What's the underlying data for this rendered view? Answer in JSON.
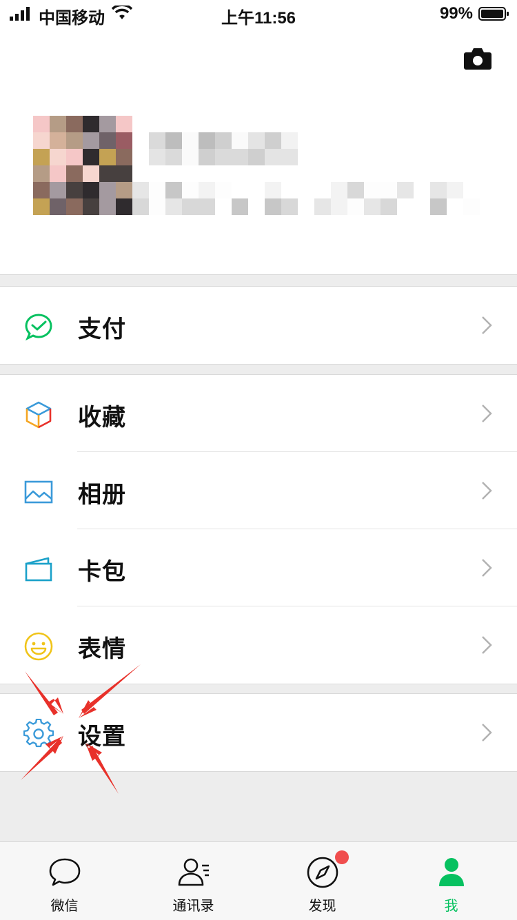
{
  "status_bar": {
    "carrier": "中国移动",
    "time": "上午11:56",
    "battery": "99%"
  },
  "profile": {
    "camera_icon": "camera-icon",
    "avatar_icon": "avatar-pixelated"
  },
  "menu_groups": [
    {
      "items": [
        {
          "label": "支付",
          "icon": "pay-icon"
        }
      ]
    },
    {
      "items": [
        {
          "label": "收藏",
          "icon": "favorites-icon"
        },
        {
          "label": "相册",
          "icon": "album-icon"
        },
        {
          "label": "卡包",
          "icon": "card-wallet-icon"
        },
        {
          "label": "表情",
          "icon": "sticker-icon"
        }
      ]
    },
    {
      "items": [
        {
          "label": "设置",
          "icon": "settings-icon"
        }
      ]
    }
  ],
  "tab_bar": {
    "tabs": [
      {
        "label": "微信",
        "icon": "chat-icon",
        "active": false
      },
      {
        "label": "通讯录",
        "icon": "contacts-icon",
        "active": false
      },
      {
        "label": "发现",
        "icon": "discover-icon",
        "active": false,
        "badge": true
      },
      {
        "label": "我",
        "icon": "me-icon",
        "active": true
      }
    ]
  },
  "colors": {
    "accent_green": "#07c160",
    "badge_red": "#f04e4e",
    "arrow_red": "#e8312a",
    "background": "#ededed"
  }
}
